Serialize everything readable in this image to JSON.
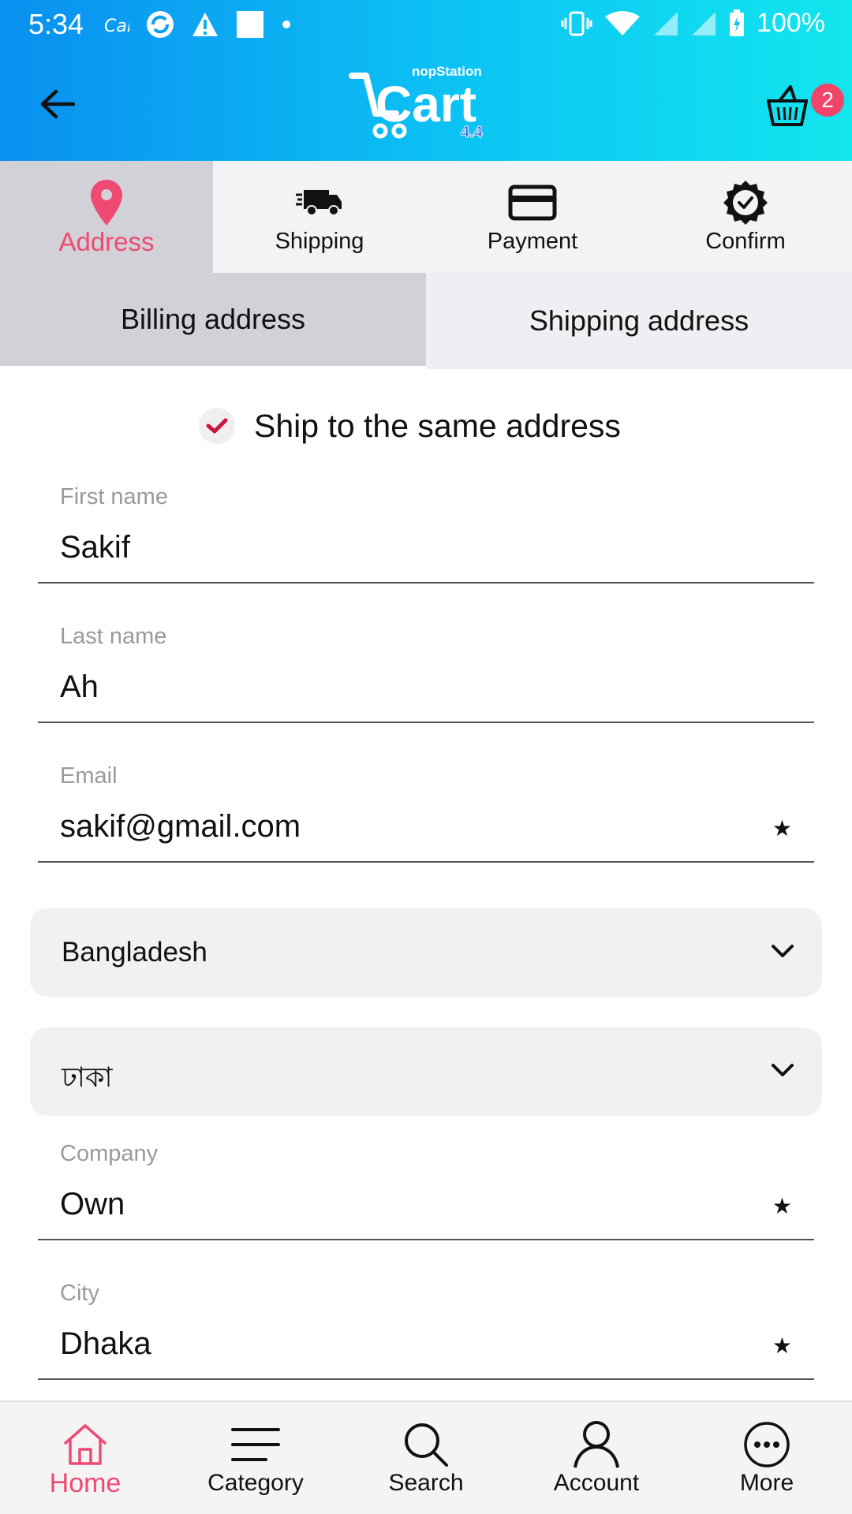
{
  "status_bar": {
    "time": "5:34",
    "battery": "100%"
  },
  "app_bar": {
    "logo_brand": "nopStation",
    "logo_text": "Cart",
    "logo_version": "4.4",
    "cart_count": "2"
  },
  "checkout_steps": [
    {
      "label": "Address",
      "icon": "location-pin-icon",
      "active": true
    },
    {
      "label": "Shipping",
      "icon": "truck-icon",
      "active": false
    },
    {
      "label": "Payment",
      "icon": "credit-card-icon",
      "active": false
    },
    {
      "label": "Confirm",
      "icon": "badge-check-icon",
      "active": false
    }
  ],
  "address_tabs": [
    {
      "label": "Billing address",
      "active": true
    },
    {
      "label": "Shipping address",
      "active": false
    }
  ],
  "ship_same": {
    "label": "Ship to the same address",
    "checked": true
  },
  "form": {
    "first_name": {
      "label": "First name",
      "value": "Sakif"
    },
    "last_name": {
      "label": "Last name",
      "value": "Ah"
    },
    "email": {
      "label": "Email",
      "value": "sakif@gmail.com",
      "required_mark": "★"
    },
    "country": {
      "value": "Bangladesh"
    },
    "state": {
      "value": "ঢাকা"
    },
    "company": {
      "label": "Company",
      "value": "Own",
      "required_mark": "★"
    },
    "city": {
      "label": "City",
      "value": "Dhaka",
      "required_mark": "★"
    }
  },
  "bottom_nav": [
    {
      "label": "Home",
      "icon": "home-icon",
      "active": true
    },
    {
      "label": "Category",
      "icon": "menu-icon",
      "active": false
    },
    {
      "label": "Search",
      "icon": "search-icon",
      "active": false
    },
    {
      "label": "Account",
      "icon": "person-icon",
      "active": false
    },
    {
      "label": "More",
      "icon": "more-icon",
      "active": false
    }
  ],
  "colors": {
    "accent": "#ef4a72",
    "header_start": "#0a8ff0",
    "header_end": "#12e6ee",
    "check": "#c8173c"
  }
}
